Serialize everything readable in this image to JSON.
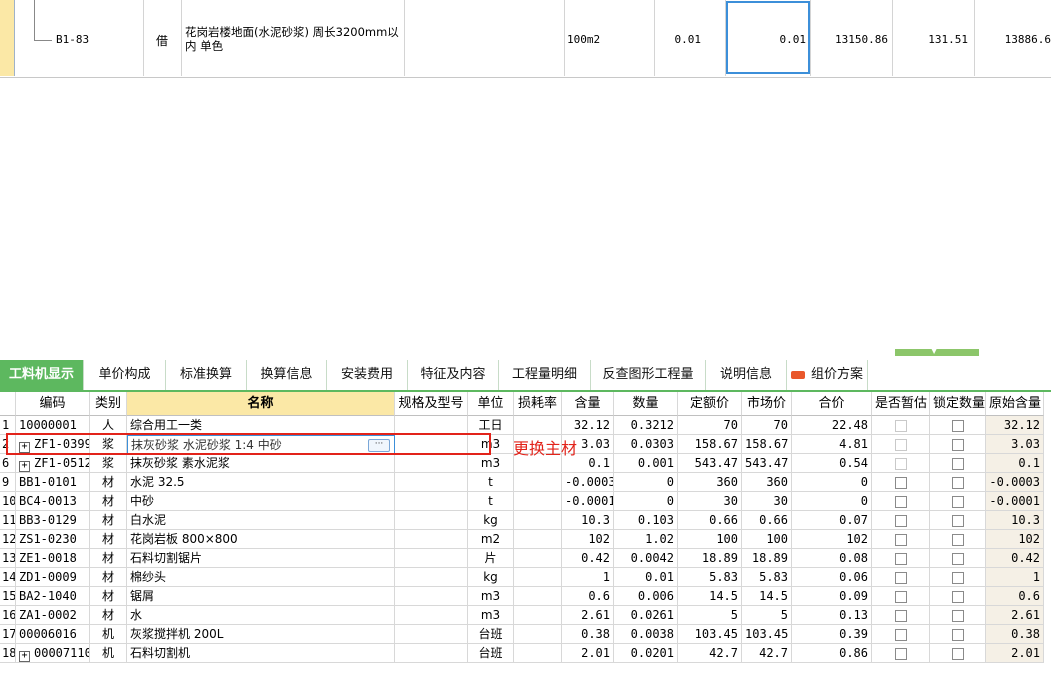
{
  "top_row": {
    "code": "B1-83",
    "type": "借",
    "name": "花岗岩楼地面(水泥砂浆) 周长3200mm以内 单色",
    "unit": "100m2",
    "v1": "0.01",
    "v2": "0.01",
    "v3": "13150.86",
    "v4": "131.51",
    "v5": "13886.6"
  },
  "tabs": [
    {
      "label": "工料机显示"
    },
    {
      "label": "单价构成"
    },
    {
      "label": "标准换算"
    },
    {
      "label": "换算信息"
    },
    {
      "label": "安装费用"
    },
    {
      "label": "特征及内容"
    },
    {
      "label": "工程量明细"
    },
    {
      "label": "反查图形工程量"
    },
    {
      "label": "说明信息"
    },
    {
      "label": "组价方案"
    }
  ],
  "columns": [
    "编码",
    "类别",
    "名称",
    "规格及型号",
    "单位",
    "损耗率",
    "含量",
    "数量",
    "定额价",
    "市场价",
    "合价",
    "是否暂估",
    "锁定数量",
    "原始含量"
  ],
  "rows": [
    {
      "idx": "1",
      "code": "10000001",
      "cat": "人",
      "name": "综合用工一类",
      "unit": "工日",
      "qty": "32.12",
      "num": "0.3212",
      "quota": "70",
      "market": "70",
      "total": "22.48",
      "orig": "32.12"
    },
    {
      "idx": "2",
      "code": "ZF1-0399",
      "cat": "浆",
      "name": "抹灰砂浆 水泥砂浆 1:4 中砂",
      "unit": "m3",
      "qty": "3.03",
      "num": "0.0303",
      "quota": "158.67",
      "market": "158.67",
      "total": "4.81",
      "orig": "3.03"
    },
    {
      "idx": "6",
      "code": "ZF1-0512",
      "cat": "浆",
      "name": "抹灰砂浆 素水泥浆",
      "unit": "m3",
      "qty": "0.1",
      "num": "0.001",
      "quota": "543.47",
      "market": "543.47",
      "total": "0.54",
      "orig": "0.1"
    },
    {
      "idx": "9",
      "code": "BB1-0101",
      "cat": "材",
      "name": "水泥 32.5",
      "unit": "t",
      "qty": "-0.0003",
      "num": "0",
      "quota": "360",
      "market": "360",
      "total": "0",
      "orig": "-0.0003"
    },
    {
      "idx": "10",
      "code": "BC4-0013",
      "cat": "材",
      "name": "中砂",
      "unit": "t",
      "qty": "-0.0001",
      "num": "0",
      "quota": "30",
      "market": "30",
      "total": "0",
      "orig": "-0.0001"
    },
    {
      "idx": "11",
      "code": "BB3-0129",
      "cat": "材",
      "name": "白水泥",
      "unit": "kg",
      "qty": "10.3",
      "num": "0.103",
      "quota": "0.66",
      "market": "0.66",
      "total": "0.07",
      "orig": "10.3"
    },
    {
      "idx": "12",
      "code": "ZS1-0230",
      "cat": "材",
      "name": "花岗岩板 800×800",
      "unit": "m2",
      "qty": "102",
      "num": "1.02",
      "quota": "100",
      "market": "100",
      "total": "102",
      "orig": "102"
    },
    {
      "idx": "13",
      "code": "ZE1-0018",
      "cat": "材",
      "name": "石料切割锯片",
      "unit": "片",
      "qty": "0.42",
      "num": "0.0042",
      "quota": "18.89",
      "market": "18.89",
      "total": "0.08",
      "orig": "0.42"
    },
    {
      "idx": "14",
      "code": "ZD1-0009",
      "cat": "材",
      "name": "棉纱头",
      "unit": "kg",
      "qty": "1",
      "num": "0.01",
      "quota": "5.83",
      "market": "5.83",
      "total": "0.06",
      "orig": "1"
    },
    {
      "idx": "15",
      "code": "BA2-1040",
      "cat": "材",
      "name": "锯屑",
      "unit": "m3",
      "qty": "0.6",
      "num": "0.006",
      "quota": "14.5",
      "market": "14.5",
      "total": "0.09",
      "orig": "0.6"
    },
    {
      "idx": "16",
      "code": "ZA1-0002",
      "cat": "材",
      "name": "水",
      "unit": "m3",
      "qty": "2.61",
      "num": "0.0261",
      "quota": "5",
      "market": "5",
      "total": "0.13",
      "orig": "2.61"
    },
    {
      "idx": "17",
      "code": "00006016",
      "cat": "机",
      "name": "灰浆搅拌机 200L",
      "unit": "台班",
      "qty": "0.38",
      "num": "0.0038",
      "quota": "103.45",
      "market": "103.45",
      "total": "0.39",
      "orig": "0.38"
    },
    {
      "idx": "18",
      "code": "00007110",
      "cat": "机",
      "name": "石料切割机",
      "unit": "台班",
      "qty": "2.01",
      "num": "0.0201",
      "quota": "42.7",
      "market": "42.7",
      "total": "0.86",
      "orig": "2.01"
    }
  ],
  "annotation": "更换主材",
  "icons": {
    "expand": "+",
    "ellipsis": "···",
    "new_badge": "new-badge-icon"
  },
  "colors": {
    "accent_green": "#5db85f",
    "highlight_yellow": "#fbe8a6",
    "annotation_red": "#e2231a",
    "selection_blue": "#3c8fd9"
  }
}
